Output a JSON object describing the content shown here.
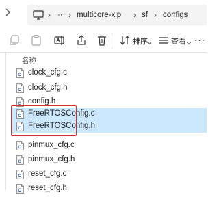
{
  "address_bar": {
    "segments": [
      "multicore-xip",
      "sf",
      "configs"
    ],
    "more": "···"
  },
  "toolbar": {
    "sort_label": "排序",
    "view_label": "查看"
  },
  "list": {
    "column_name": "名称",
    "files": [
      {
        "name": "clock_cfg.c",
        "selected": false
      },
      {
        "name": "clock_cfg.h",
        "selected": false
      },
      {
        "name": "config.h",
        "selected": false
      },
      {
        "name": "FreeRTOSConfig.c",
        "selected": true
      },
      {
        "name": "FreeRTOSConfig.h",
        "selected": true
      },
      {
        "name": "pinmux_cfg.c",
        "selected": false
      },
      {
        "name": "pinmux_cfg.h",
        "selected": false
      },
      {
        "name": "reset_cfg.c",
        "selected": false
      },
      {
        "name": "reset_cfg.h",
        "selected": false
      }
    ]
  },
  "colors": {
    "selection": "#cce8ff",
    "highlight_border": "#e02b2b"
  }
}
